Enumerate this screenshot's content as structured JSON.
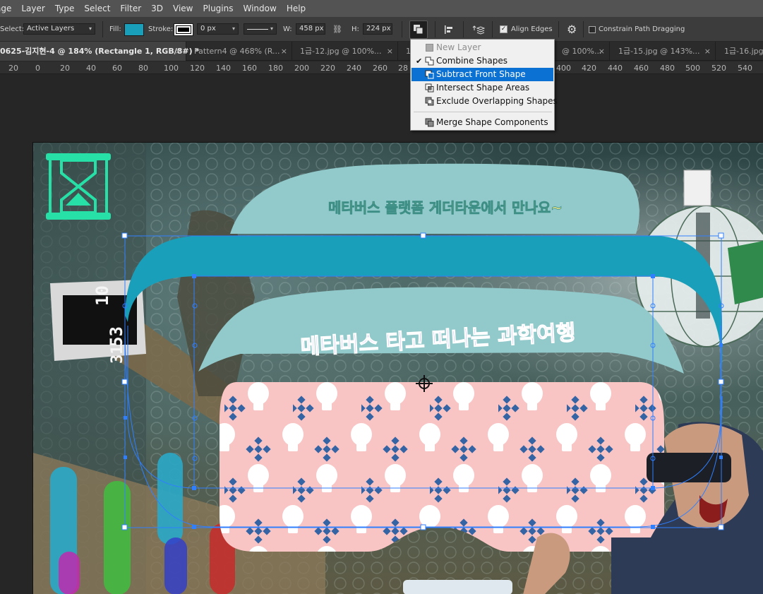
{
  "menu": [
    "age",
    "Layer",
    "Type",
    "Select",
    "Filter",
    "3D",
    "View",
    "Plugins",
    "Window",
    "Help"
  ],
  "options": {
    "select_label": "Select:",
    "select_value": "Active Layers",
    "fill_label": "Fill:",
    "fill_color": "#1a9fba",
    "stroke_label": "Stroke:",
    "stroke_width": "0 px",
    "w_label": "W:",
    "w_value": "458 px",
    "h_label": "H:",
    "h_value": "224 px",
    "align_edges_label": "Align Edges",
    "align_edges_checked": true,
    "constrain_label": "Constrain Path Dragging",
    "constrain_checked": false
  },
  "tabs": [
    {
      "label": "0625-김지현-4 @ 184% (Rectangle 1, RGB/8#) *",
      "close": "×",
      "active": true
    },
    {
      "label": "Pattern4 @ 468% (R...",
      "close": "×",
      "active": false
    },
    {
      "label": "1급-12.jpg @ 100%...",
      "close": "×",
      "active": false
    },
    {
      "label": "1",
      "close": "",
      "active": false
    },
    {
      "label": "@ 100%...",
      "close": "×",
      "active": false
    },
    {
      "label": "1급-15.jpg @ 143%...",
      "close": "×",
      "active": false
    },
    {
      "label": "1급-16.jpg",
      "close": "",
      "active": false
    }
  ],
  "ruler_ticks": [
    "20",
    "0",
    "20",
    "40",
    "60",
    "80",
    "100",
    "120",
    "140",
    "160",
    "180",
    "200",
    "220",
    "240",
    "260",
    "28",
    "400",
    "420",
    "440",
    "460",
    "480",
    "500",
    "520",
    "540"
  ],
  "path_ops_menu": {
    "items": [
      {
        "label": "New Layer",
        "disabled": true,
        "checked": false,
        "selected": false
      },
      {
        "label": "Combine Shapes",
        "disabled": false,
        "checked": true,
        "selected": false
      },
      {
        "label": "Subtract Front Shape",
        "disabled": false,
        "checked": false,
        "selected": true
      },
      {
        "label": "Intersect Shape Areas",
        "disabled": false,
        "checked": false,
        "selected": false
      },
      {
        "label": "Exclude Overlapping Shapes",
        "disabled": false,
        "checked": false,
        "selected": false
      },
      {
        "label": "Merge Shape Components",
        "disabled": false,
        "checked": false,
        "selected": false
      }
    ]
  },
  "canvas_text": {
    "top_banner": "메타버스 플랫폼 게더타운에서 만나요~",
    "arc_title": "메타버스 타고 떠나는 과학여행",
    "clock_h": "10",
    "clock_m": "53",
    "clock_s": "31"
  },
  "colors": {
    "selected_shape": "#1a9fba",
    "light_teal": "#92c9ca",
    "pink": "#f9c4c4",
    "diamond_blue": "#3564a5",
    "path_blue": "#2f7fff",
    "menu_highlight": "#0b71d3"
  }
}
